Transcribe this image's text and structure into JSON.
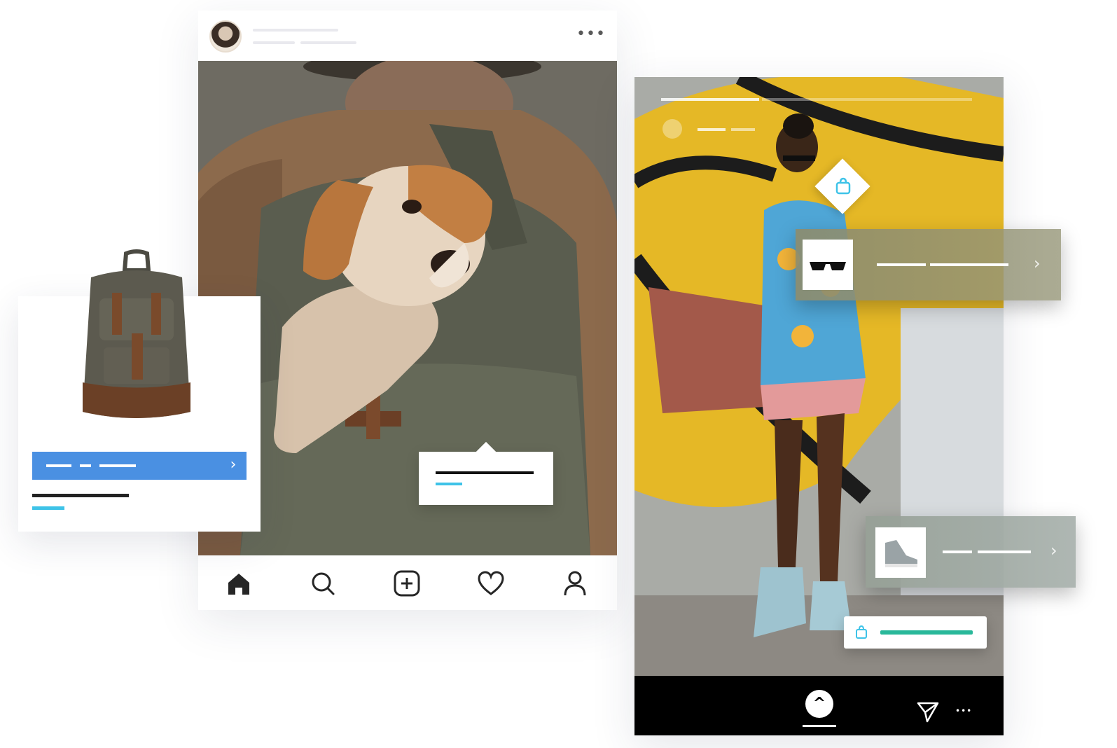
{
  "post": {
    "header": {
      "avatar_icon": "profile-avatar",
      "more_icon": "more-dots-icon",
      "more_glyph": "•••"
    },
    "bottom_nav": {
      "items": [
        {
          "icon": "home-icon",
          "active": true
        },
        {
          "icon": "search-icon",
          "active": false
        },
        {
          "icon": "add-post-icon",
          "active": false
        },
        {
          "icon": "heart-icon",
          "active": false
        },
        {
          "icon": "profile-icon",
          "active": false
        }
      ]
    },
    "product_tag": {
      "icon": "product-tag-bubble"
    }
  },
  "product_card": {
    "image": "backpack-image",
    "button_icon": "chevron-right-icon",
    "button_glyph": "›",
    "button_color": "#4a90e2",
    "price_color": "#3ec3e8"
  },
  "story": {
    "stickers": [
      {
        "thumb": "sunglasses-thumbnail",
        "chevron": "›"
      },
      {
        "thumb": "sneaker-thumbnail",
        "chevron": "›"
      }
    ],
    "shop_pill": {
      "icon": "shopping-bag-icon",
      "bar_color": "#29b89a"
    },
    "product_pin": {
      "icon": "shopping-bag-icon"
    },
    "footer": {
      "swipe_up_icon": "chevron-up-icon",
      "swipe_up_glyph": "^",
      "send_icon": "send-icon",
      "more_icon": "more-dots-icon",
      "more_glyph": "•••"
    }
  }
}
